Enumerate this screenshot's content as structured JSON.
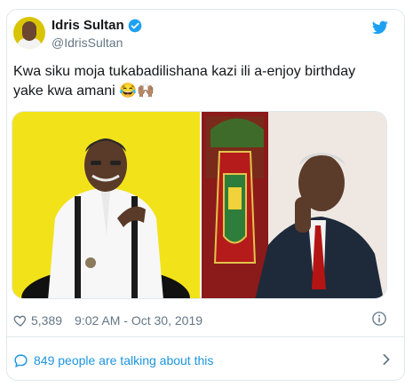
{
  "author": {
    "name": "Idris Sultan",
    "handle": "@IdrisSultan"
  },
  "tweet": {
    "text": "Kwa siku moja tukabadilishana kazi ili a-enjoy birthday yake kwa amani 😂🙌🏽"
  },
  "stats": {
    "likes": "5,389",
    "timestamp": "9:02 AM - Oct 30, 2019"
  },
  "footer": {
    "talking": "849 people are talking about this"
  },
  "icons": {
    "verified": "verified-badge-icon",
    "brand": "twitter-bird-icon",
    "like": "heart-icon",
    "info": "info-icon",
    "reply": "speech-bubble-icon",
    "chevron": "chevron-right-icon"
  },
  "colors": {
    "brand": "#1da1f2",
    "link": "#1b95e0",
    "muted": "#657786",
    "text": "#14171a",
    "left_photo_bg": "#f2e21a"
  }
}
